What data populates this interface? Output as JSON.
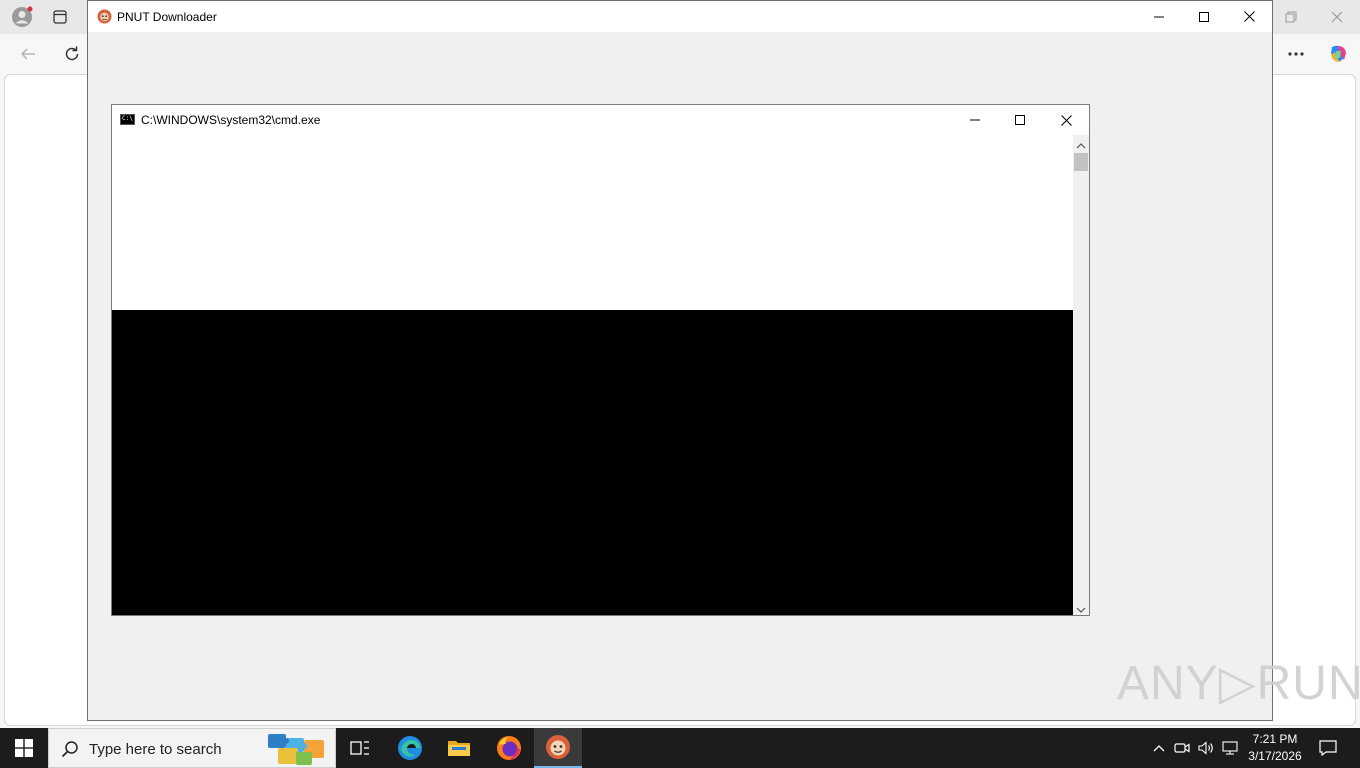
{
  "pnut_window": {
    "title": "PNUT Downloader",
    "minimize_glyph": "—",
    "maximize_glyph": "□",
    "close_glyph": "✕"
  },
  "cmd_window": {
    "title": "C:\\WINDOWS\\system32\\cmd.exe",
    "icon_text": "C:\\"
  },
  "watermark": {
    "text": "ANY▷RUN"
  },
  "taskbar": {
    "search_placeholder": "Type here to search",
    "clock_time": "7:21 PM",
    "clock_date": "3/17/2026",
    "items": [
      "task-view",
      "edge",
      "file-explorer",
      "firefox",
      "pnut-downloader"
    ],
    "active_item": "pnut-downloader",
    "accent_color": "#76b9ed"
  },
  "colors": {
    "taskbar_bg": "#1c1c1c",
    "cmd_bg": "#000000"
  }
}
